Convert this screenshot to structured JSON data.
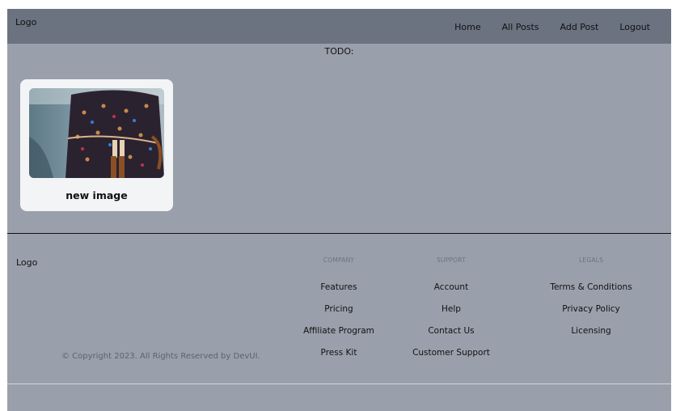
{
  "header": {
    "logo": "Logo",
    "nav": [
      "Home",
      "All Posts",
      "Add Post",
      "Logout"
    ]
  },
  "main": {
    "todo": "TODO:",
    "posts": [
      {
        "title": "new image"
      }
    ]
  },
  "footer": {
    "logo": "Logo",
    "copyright": "© Copyright 2023. All Rights Reserved by DevUI.",
    "company": {
      "heading": "COMPANY",
      "links": [
        "Features",
        "Pricing",
        "Affiliate Program",
        "Press Kit"
      ]
    },
    "support": {
      "heading": "SUPPORT",
      "links": [
        "Account",
        "Help",
        "Contact Us",
        "Customer Support"
      ]
    },
    "legals": {
      "heading": "LEGALS",
      "links": [
        "Terms & Conditions",
        "Privacy Policy",
        "Licensing"
      ]
    }
  },
  "colors": {
    "header_bg": "#6b7280",
    "page_bg": "#9aa0ab",
    "card_bg": "#f3f4f6"
  }
}
